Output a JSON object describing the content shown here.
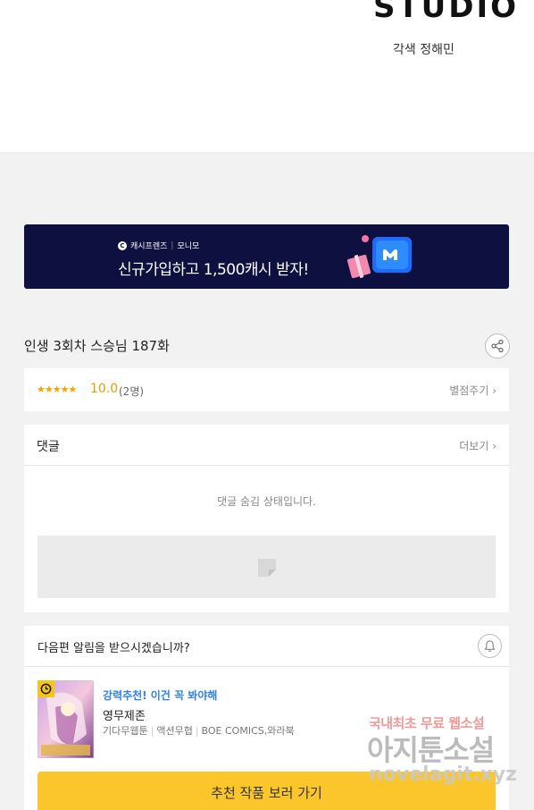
{
  "header": {
    "studio_logo_text": "STUDIO",
    "credit": "각색 정해민"
  },
  "banner": {
    "brand_left": "캐시프렌즈",
    "brand_right": "모니모",
    "headline": "신규가입하고 1,500캐시 받자!",
    "bg_color": "#0e1140"
  },
  "episode": {
    "title": "인생 3회차 스승님 187화",
    "share_icon": "share-icon"
  },
  "rating": {
    "stars": "★★★★★",
    "score": "10.0",
    "count": "(2명)",
    "rate_label": "별점주기 ›"
  },
  "comments": {
    "title": "댓글",
    "more_label": "더보기 ›",
    "hidden_notice": "댓글 숨김 상태입니다."
  },
  "notify": {
    "question": "다음편 알림을 받으시겠습니까?",
    "bell_icon": "bell-icon"
  },
  "recommend": {
    "tag": "강력추천! 이건 꼭 봐야해",
    "title": "영무제존",
    "genre1": "기다무웹툰",
    "genre2": "액션무협",
    "publisher": "BOE COMICS,와라북",
    "button_label": "추천 작품 보러 가기",
    "button_color": "#fbc62c",
    "tag_color": "#2f80ed"
  },
  "watermark": {
    "line1": "국내최초 무료 웹소설",
    "line2": "아지툰소설",
    "line3": "novelagit.xyz"
  }
}
